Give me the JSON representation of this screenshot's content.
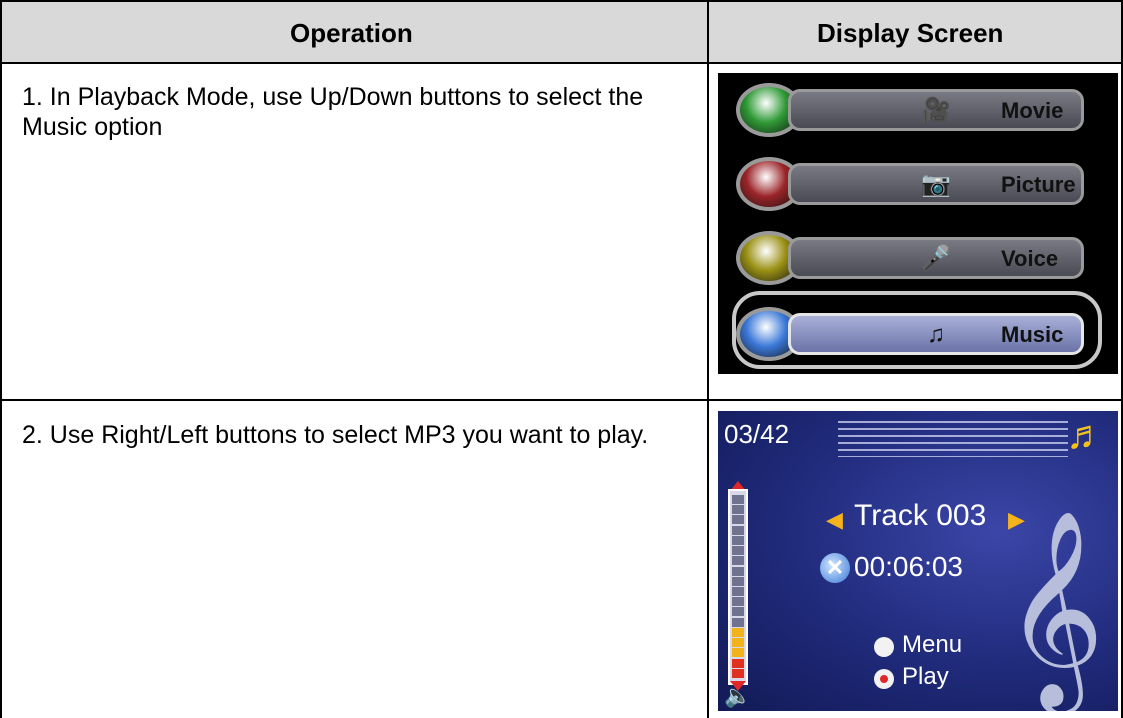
{
  "headers": {
    "operation": "Operation",
    "display_screen": "Display Screen"
  },
  "rows": [
    {
      "step_text": "1. In Playback Mode, use Up/Down buttons to select the Music option"
    },
    {
      "step_text": "2. Use Right/Left buttons to select MP3 you want to play."
    }
  ],
  "playback_menu": {
    "items": [
      {
        "label": "Movie",
        "icon": "movie-camera-icon",
        "orb_color": "#2f9a36"
      },
      {
        "label": "Picture",
        "icon": "camera-icon",
        "orb_color": "#9a2428"
      },
      {
        "label": "Voice",
        "icon": "microphone-icon",
        "orb_color": "#9a9014"
      },
      {
        "label": "Music",
        "icon": "music-notes-icon",
        "orb_color": "#3b78d8",
        "selected": true
      }
    ]
  },
  "music_player": {
    "counter": "03/42",
    "track": "Track 003",
    "time": "00:06:03",
    "volume_level": 0.3,
    "options": [
      {
        "label": "Menu",
        "icon": "circle-button-icon"
      },
      {
        "label": "Play",
        "icon": "record-button-icon"
      }
    ]
  }
}
